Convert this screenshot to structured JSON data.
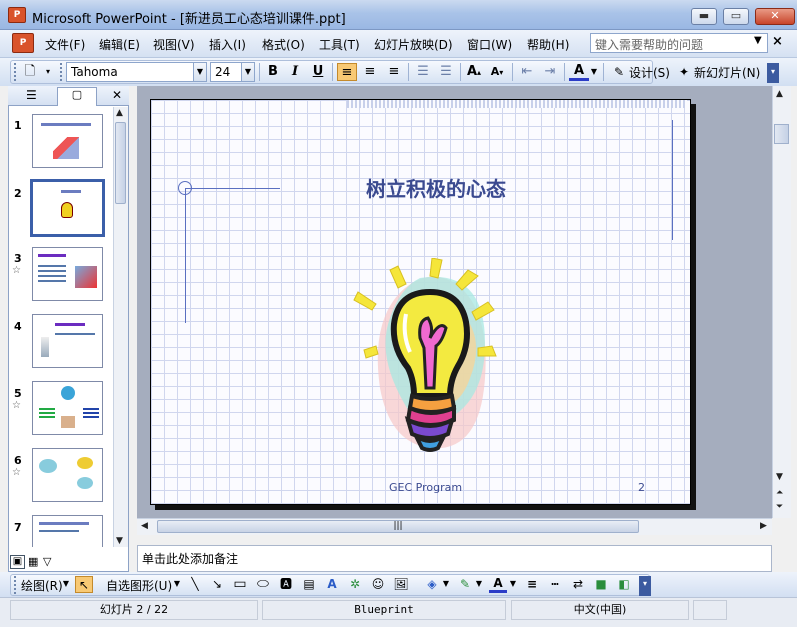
{
  "window": {
    "title": "Microsoft PowerPoint - [新进员工心态培训课件.ppt]",
    "app_icon": "ppt-icon",
    "minimize": "▬",
    "maximize": "▭",
    "close": "✕"
  },
  "menu": {
    "items": [
      "文件(F)",
      "编辑(E)",
      "视图(V)",
      "插入(I)",
      "格式(O)",
      "工具(T)",
      "幻灯片放映(D)",
      "窗口(W)",
      "帮助(H)"
    ],
    "help_placeholder": "键入需要帮助的问题",
    "close_doc": "×"
  },
  "toolbar": {
    "font_name": "Tahoma",
    "font_size": "24",
    "bold": "B",
    "italic": "I",
    "underline": "U",
    "design_label": "设计(S)",
    "new_slide_label": "新幻灯片(N)"
  },
  "left_pane": {
    "slides": [
      {
        "num": "1",
        "star": ""
      },
      {
        "num": "2",
        "star": ""
      },
      {
        "num": "3",
        "star": "☆"
      },
      {
        "num": "4",
        "star": ""
      },
      {
        "num": "5",
        "star": "☆"
      },
      {
        "num": "6",
        "star": "☆"
      },
      {
        "num": "7",
        "star": ""
      }
    ],
    "close_icon": "✕"
  },
  "slide": {
    "title": "树立积极的心态",
    "footer": "GEC Program",
    "number": "2"
  },
  "notes": {
    "placeholder": "单击此处添加备注"
  },
  "drawing_toolbar": {
    "draw_label": "绘图(R)",
    "autoshapes_label": "自选图形(U)"
  },
  "status": {
    "slide_info": "幻灯片 2 / 22",
    "template": "Blueprint",
    "language": "中文(中国)"
  },
  "colors": {
    "title_color": "#3b4a90",
    "accent": "#3b5fa9"
  }
}
